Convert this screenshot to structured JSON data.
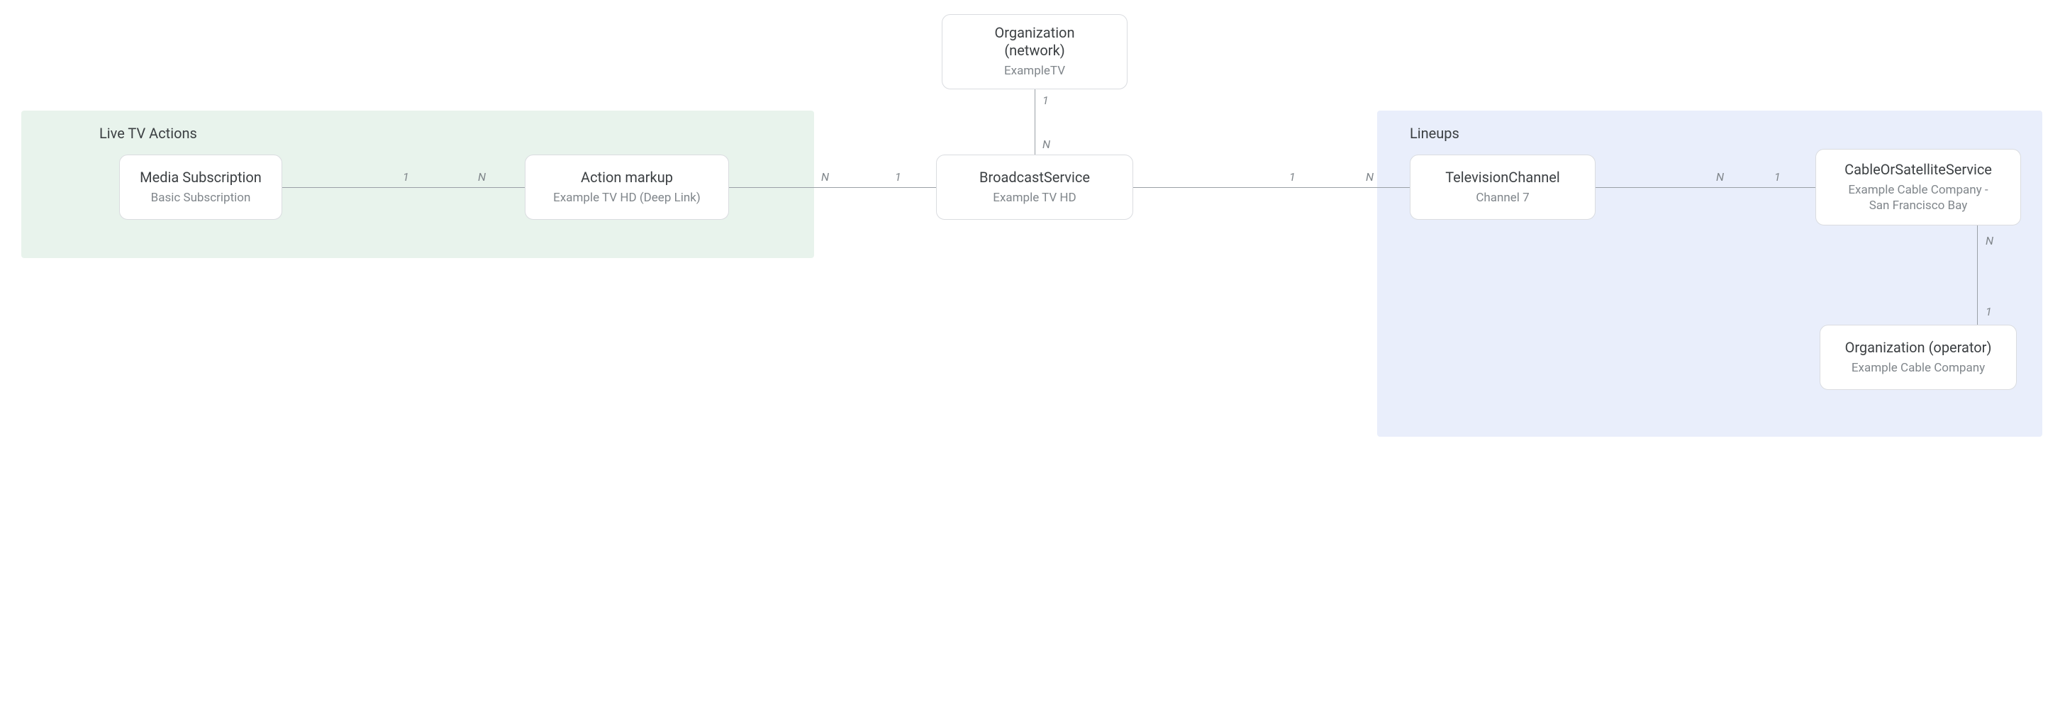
{
  "groups": {
    "live_tv_actions": {
      "label": "Live TV Actions"
    },
    "lineups": {
      "label": "Lineups"
    }
  },
  "nodes": {
    "organization_network": {
      "title": "Organization\n(network)",
      "subtitle": "ExampleTV"
    },
    "media_subscription": {
      "title": "Media Subscription",
      "subtitle": "Basic Subscription"
    },
    "action_markup": {
      "title": "Action markup",
      "subtitle": "Example TV HD (Deep Link)"
    },
    "broadcast_service": {
      "title": "BroadcastService",
      "subtitle": "Example TV HD"
    },
    "television_channel": {
      "title": "TelevisionChannel",
      "subtitle": "Channel 7"
    },
    "cable_or_satellite_service": {
      "title": "CableOrSatelliteService",
      "subtitle": "Example Cable Company -\nSan Francisco Bay"
    },
    "organization_operator": {
      "title": "Organization (operator)",
      "subtitle": "Example Cable Company"
    }
  },
  "edges": {
    "org_to_broadcast": {
      "left": "1",
      "right": "N"
    },
    "media_to_action": {
      "left": "1",
      "right": "N"
    },
    "action_to_broadcast": {
      "left": "N",
      "right": "1"
    },
    "broadcast_to_tv": {
      "left": "1",
      "right": "N"
    },
    "tv_to_cable": {
      "left": "N",
      "right": "1"
    },
    "cable_to_operator": {
      "left": "N",
      "right": "1"
    }
  }
}
